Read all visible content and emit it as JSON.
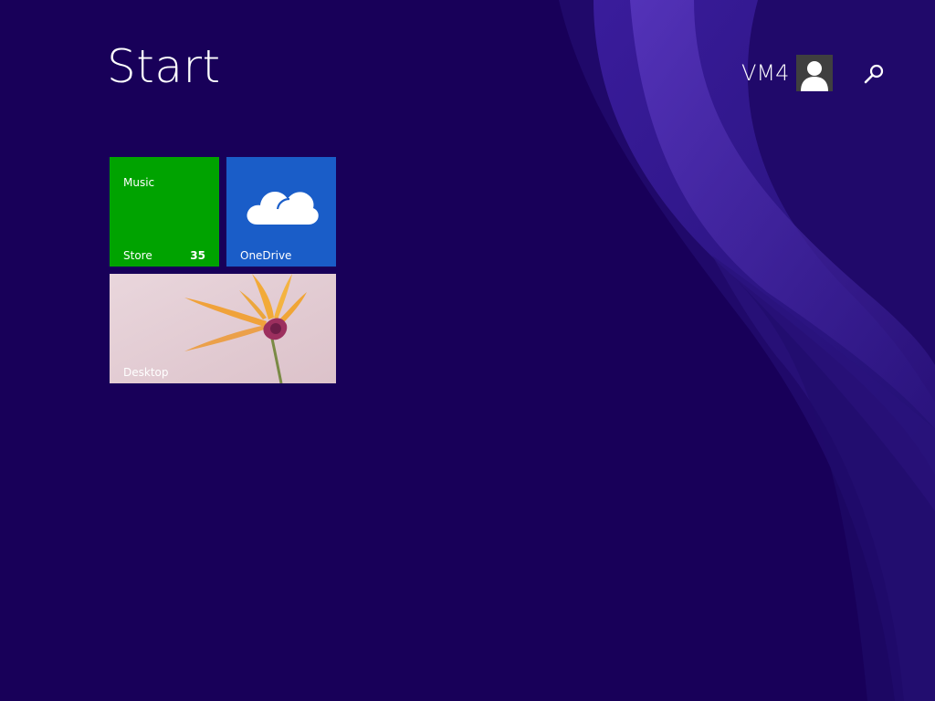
{
  "screen": {
    "title": "Start",
    "background_color": "#180059",
    "accent_swirl_color": "#3a1c9c"
  },
  "user": {
    "name": "VM4",
    "avatar_icon": "user-silhouette-icon"
  },
  "search": {
    "icon": "search-icon"
  },
  "tiles": {
    "music_store": {
      "title": "Music",
      "label": "Store",
      "badge": "35",
      "color": "#00a300"
    },
    "onedrive": {
      "label": "OneDrive",
      "icon": "cloud-icon",
      "color": "#1a5dc8"
    },
    "desktop": {
      "label": "Desktop",
      "background": "flower-wallpaper"
    }
  }
}
